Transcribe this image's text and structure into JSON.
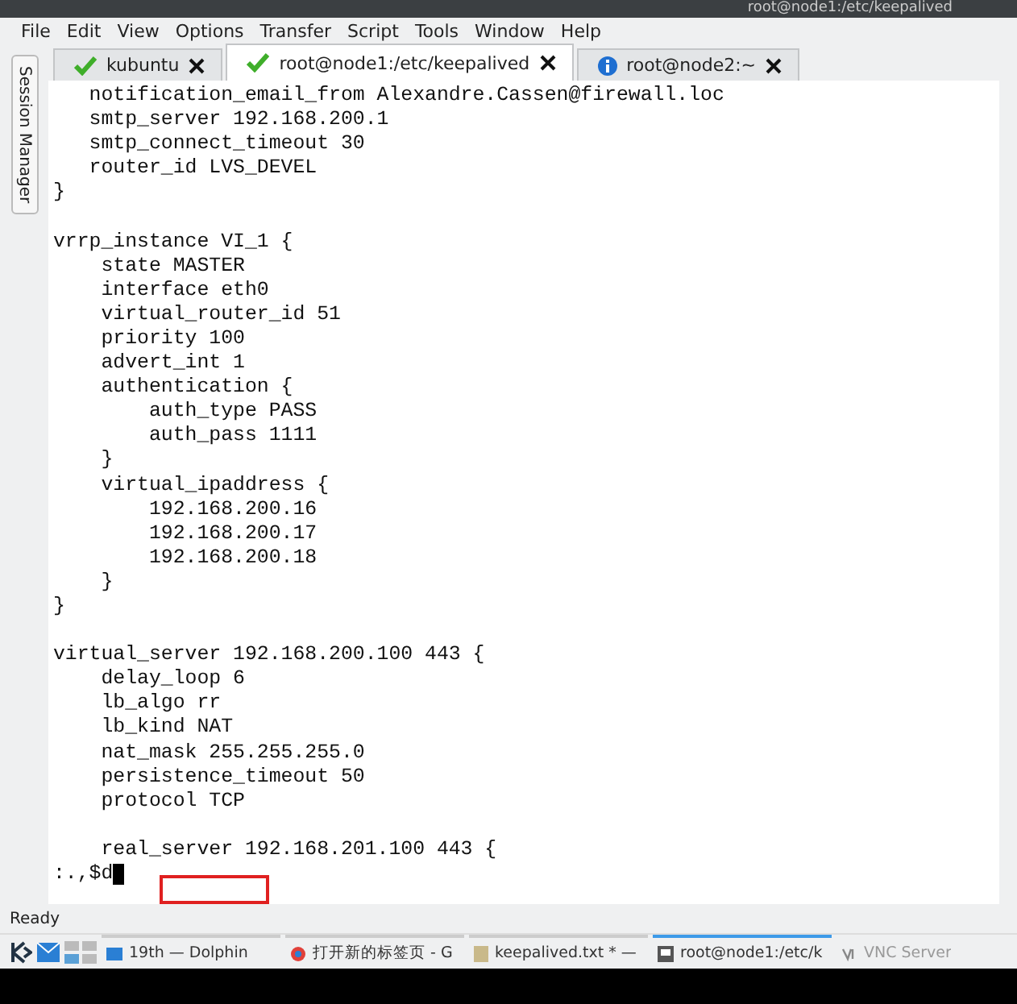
{
  "window": {
    "title": "root@node1:/etc/keepalived"
  },
  "menu": [
    "File",
    "Edit",
    "View",
    "Options",
    "Transfer",
    "Script",
    "Tools",
    "Window",
    "Help"
  ],
  "side_tab": {
    "label": "Session Manager"
  },
  "tabs": [
    {
      "label": "kubuntu",
      "kind": "connected",
      "selected": false
    },
    {
      "label": "root@node1:/etc/keepalived",
      "kind": "connected",
      "selected": true
    },
    {
      "label": "root@node2:~",
      "kind": "info",
      "selected": false
    }
  ],
  "terminal": {
    "blocks": [
      [
        "   notification_email_from Alexandre.Cassen@firewall.loc",
        "   smtp_server 192.168.200.1",
        "   smtp_connect_timeout 30",
        "   router_id LVS_DEVEL",
        "}"
      ],
      [
        "vrrp_instance VI_1 {",
        "    state MASTER",
        "    interface eth0",
        "    virtual_router_id 51",
        "    priority 100",
        "    advert_int 1",
        "    authentication {",
        "        auth_type PASS",
        "        auth_pass 1111",
        "    }",
        "    virtual_ipaddress {",
        "        192.168.200.16",
        "        192.168.200.17",
        "        192.168.200.18",
        "    }",
        "}"
      ],
      [
        "virtual_server 192.168.200.100 443 {",
        "    delay_loop 6",
        "    lb_algo rr",
        "    lb_kind NAT",
        "    nat_mask 255.255.255.0",
        "    persistence_timeout 50",
        "    protocol TCP"
      ],
      [
        "    real_server 192.168.201.100 443 {"
      ]
    ],
    "command": ":.,$d"
  },
  "status_bar": {
    "text": "Ready"
  },
  "taskbar": {
    "tasks": [
      {
        "label": "19th — Dolphin",
        "kind": "folder",
        "selected": false
      },
      {
        "label": "打开新的标签页 - G",
        "kind": "browser",
        "selected": false
      },
      {
        "label": "keepalived.txt * —",
        "kind": "document",
        "selected": false
      },
      {
        "label": "root@node1:/etc/k",
        "kind": "terminal",
        "selected": true
      },
      {
        "label": "VNC Server",
        "kind": "vnc",
        "selected": false
      }
    ]
  }
}
